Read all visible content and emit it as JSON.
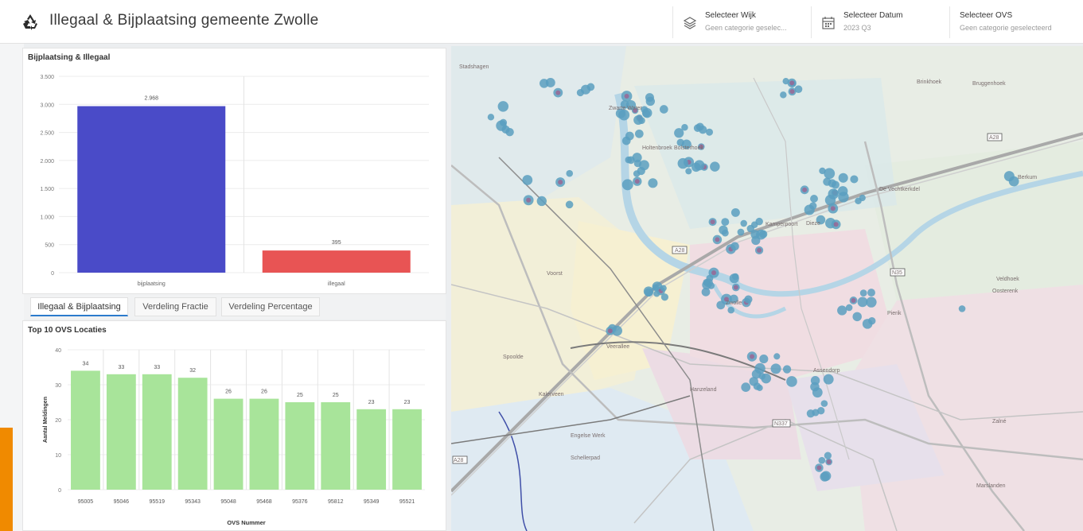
{
  "header": {
    "title": "Illegaal & Bijplaatsing gemeente Zwolle",
    "selectors": [
      {
        "label": "Selecteer Wijk",
        "value": "Geen categorie geselec..."
      },
      {
        "label": "Selecteer Datum",
        "value": "2023 Q3"
      },
      {
        "label": "Selecteer OVS",
        "value": "Geen categorie geselecteerd"
      }
    ]
  },
  "tabs": [
    "Illegaal & Bijplaatsing",
    "Verdeling Fractie",
    "Verdeling Percentage"
  ],
  "map": {
    "labels": [
      "Stadshagen",
      "Brinkhoek",
      "Bruggenhoek",
      "A28",
      "Bolsterhoek",
      "De Vechtkerkdel",
      "Holtenbroek",
      "Dieze",
      "Assendorp",
      "Veldhoek",
      "Oosterenk",
      "Spoolde",
      "Voorst",
      "Zwolle",
      "Kamperpoort",
      "Veerallee",
      "Kalerveen",
      "Hanzeland",
      "Engelse Werk",
      "Zalné",
      "Marslanden",
      "N35",
      "N337",
      "A28",
      "A28",
      "Zwarte Water",
      "Berkum",
      "Pierik",
      "Schellerpad"
    ]
  },
  "chart_data": [
    {
      "type": "bar",
      "title": "Bijplaatsing & Illegaal",
      "categories": [
        "bijplaatsing",
        "illegaal"
      ],
      "values": [
        2968,
        395
      ],
      "value_labels": [
        "2.968",
        "395"
      ],
      "colors": [
        "#4a4bc8",
        "#e85454"
      ],
      "ylim": [
        0,
        3500
      ],
      "yticks": [
        "0",
        "500",
        "1.000",
        "1.500",
        "2.000",
        "2.500",
        "3.000",
        "3.500"
      ],
      "grid": true
    },
    {
      "type": "bar",
      "title": "Top 10 OVS Locaties",
      "xlabel": "OVS Nummer",
      "ylabel": "Aantal Meldingen",
      "categories": [
        "95005",
        "95046",
        "95519",
        "95343",
        "95048",
        "95468",
        "95376",
        "95812",
        "95349",
        "95521"
      ],
      "values": [
        34,
        33,
        33,
        32,
        26,
        26,
        25,
        25,
        23,
        23
      ],
      "color": "#a8e49a",
      "ylim": [
        0,
        40
      ],
      "yticks": [
        "0",
        "10",
        "20",
        "30",
        "40"
      ],
      "grid": true
    }
  ]
}
